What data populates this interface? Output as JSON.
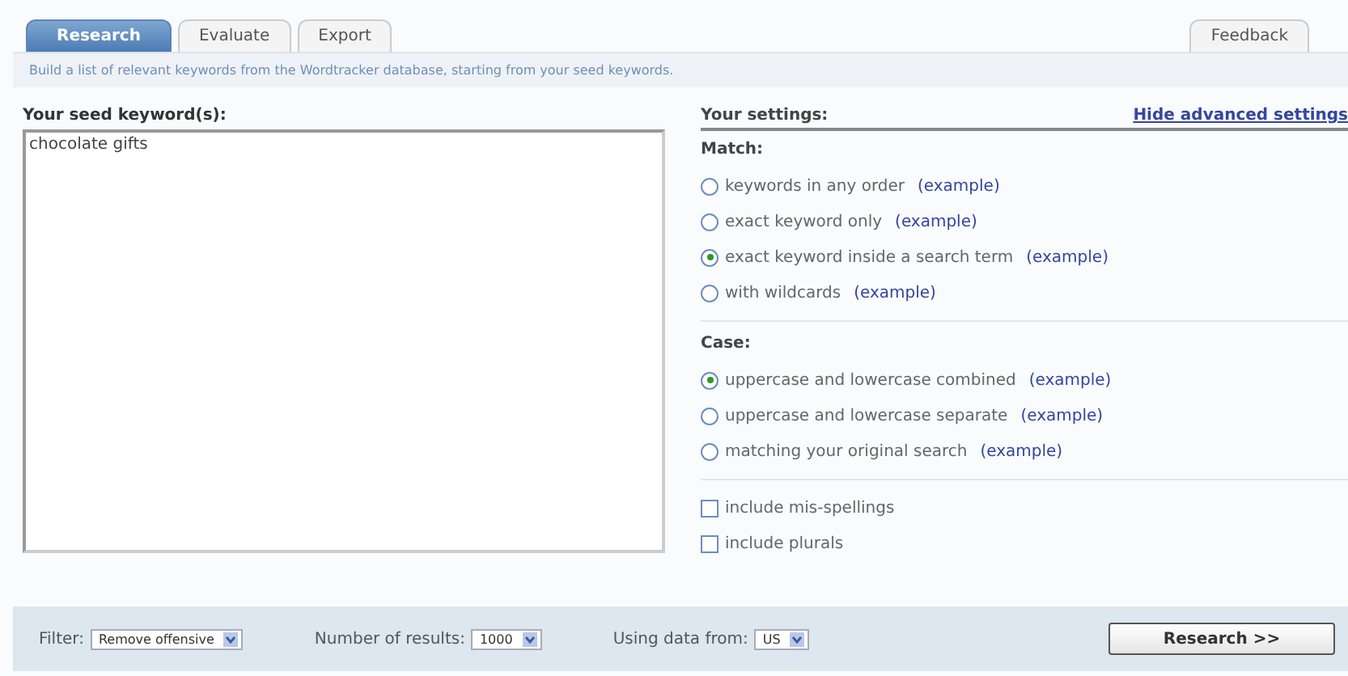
{
  "tabs": [
    {
      "label": "Research",
      "selected": true
    },
    {
      "label": "Evaluate",
      "selected": false
    },
    {
      "label": "Export",
      "selected": false
    }
  ],
  "feedback": "Feedback",
  "description": "Build a list of relevant keywords from the Wordtracker database, starting from your seed keywords.",
  "seed": {
    "label": "Your seed keyword(s):",
    "value": "chocolate gifts"
  },
  "settings": {
    "title": "Your settings:",
    "toggle_link": "Hide advanced settings",
    "groups": [
      {
        "title": "Match:",
        "options": [
          {
            "label": "keywords in any order",
            "link": "(example)",
            "selected": false
          },
          {
            "label": "exact keyword only",
            "link": "(example)",
            "selected": false
          },
          {
            "label": "exact keyword inside a search term",
            "link": "(example)",
            "selected": true
          },
          {
            "label": "with wildcards",
            "link": "(example)",
            "selected": false
          }
        ]
      },
      {
        "title": "Case:",
        "options": [
          {
            "label": "uppercase and lowercase combined",
            "link": "(example)",
            "selected": true
          },
          {
            "label": "uppercase and lowercase separate",
            "link": "(example)",
            "selected": false
          },
          {
            "label": "matching your original search",
            "link": "(example)",
            "selected": false
          }
        ]
      }
    ],
    "checkboxes": [
      {
        "label": "include mis-spellings",
        "checked": false
      },
      {
        "label": "include plurals",
        "checked": false
      }
    ]
  },
  "footer": {
    "selects": [
      {
        "label": "Filter:",
        "value": "Remove offensive"
      },
      {
        "label": "Number of results:",
        "value": "1000"
      },
      {
        "label": "Using data from:",
        "value": "US"
      }
    ],
    "button": "Research >>"
  }
}
